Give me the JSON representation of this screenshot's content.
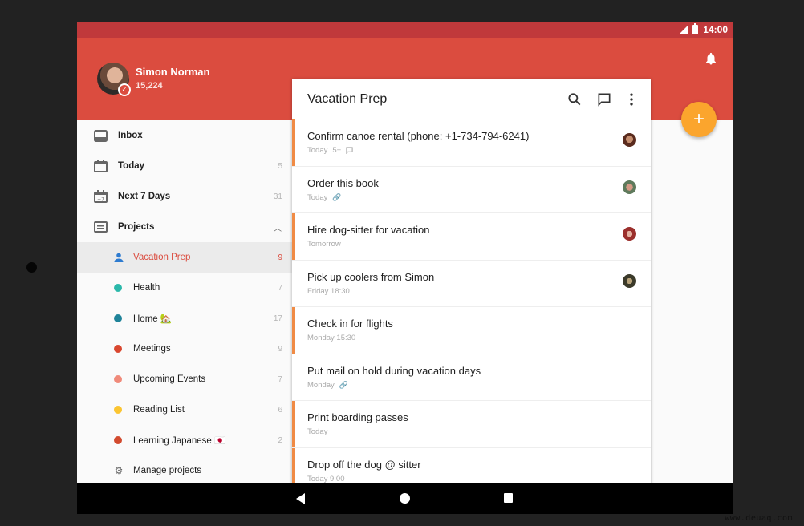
{
  "statusbar": {
    "time": "14:00"
  },
  "user": {
    "name": "Simon Norman",
    "karma": "15,224"
  },
  "sidebar": {
    "filters": [
      {
        "label": "Inbox",
        "count": "",
        "icon": "inbox-icon"
      },
      {
        "label": "Today",
        "count": "5",
        "icon": "calendar-today-icon"
      },
      {
        "label": "Next 7 Days",
        "count": "31",
        "icon": "calendar-week-icon"
      }
    ],
    "projects_label": "Projects",
    "projects": [
      {
        "label": "Vacation Prep",
        "count": "9",
        "color": "#2d7bd0",
        "shared": true,
        "active": true
      },
      {
        "label": "Health",
        "count": "7",
        "color": "#2bb8aa"
      },
      {
        "label": "Home 🏡",
        "count": "17",
        "color": "#1f8399"
      },
      {
        "label": "Meetings",
        "count": "9",
        "color": "#d9472f"
      },
      {
        "label": "Upcoming Events",
        "count": "7",
        "color": "#f08a7a"
      },
      {
        "label": "Reading List",
        "count": "6",
        "color": "#fbc531"
      },
      {
        "label": "Learning Japanese 🇯🇵",
        "count": "2",
        "color": "#d24a2e"
      }
    ],
    "manage_label": "Manage projects"
  },
  "project": {
    "title": "Vacation Prep",
    "tasks": [
      {
        "title": "Confirm canoe rental (phone: +1-734-794-6241)",
        "date": "Today",
        "comments": "5+",
        "flag": true,
        "avatar": "#6b3b2b"
      },
      {
        "title": "Order this book",
        "date": "Today",
        "link": true,
        "flag": false,
        "avatar": "#7a8a70"
      },
      {
        "title": "Hire dog-sitter for vacation",
        "date": "Tomorrow",
        "flag": true,
        "avatar": "#a0403a"
      },
      {
        "title": "Pick up coolers from Simon",
        "date": "Friday 18:30",
        "flag": false,
        "avatar": "#5a5a3a"
      },
      {
        "title": "Check in for flights",
        "date": "Monday 15:30",
        "flag": true
      },
      {
        "title": "Put mail on hold during vacation days",
        "date": "Monday",
        "link": true,
        "flag": false
      },
      {
        "title": "Print boarding passes",
        "date": "Today",
        "flag": true
      },
      {
        "title": "Drop off the dog @ sitter",
        "date": "Today 9:00",
        "flag": true
      }
    ]
  },
  "fab_label": "+",
  "watermark": "www.deuaq.com",
  "colors": {
    "primary": "#db4c3f",
    "statusbar": "#c0393b",
    "fab": "#fba52d",
    "priority": "#f08b45"
  }
}
